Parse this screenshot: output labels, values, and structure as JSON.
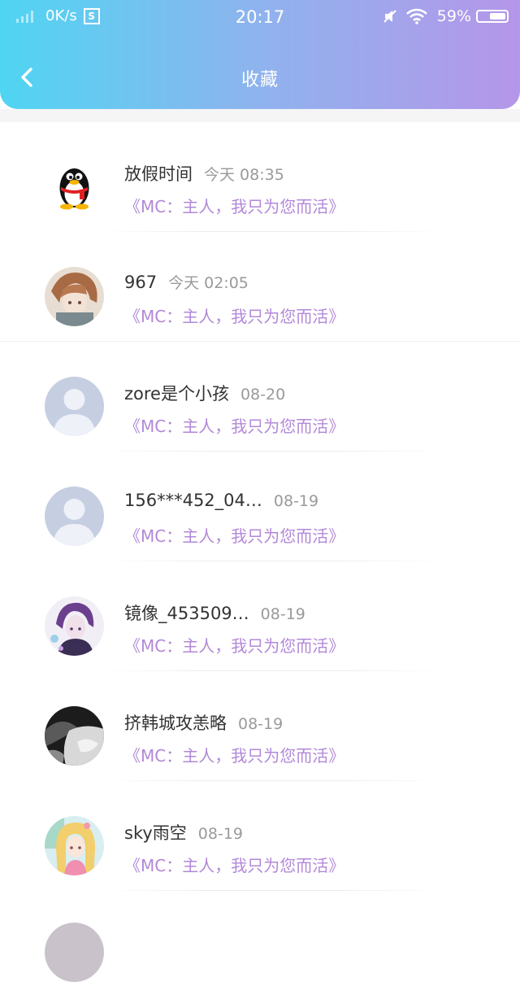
{
  "status_bar": {
    "speed": "0K/s",
    "s_icon": "S",
    "time": "20:17",
    "battery": "59%",
    "battery_level": 0.59
  },
  "header": {
    "title": "收藏",
    "back_icon": "chevron-left-icon"
  },
  "items": [
    {
      "name": "放假时间",
      "time": "今天 08:35",
      "desc": "《MC：主人，我只为您而活》",
      "avatar": "qq-penguin"
    },
    {
      "name": "967",
      "time": "今天 02:05",
      "desc": "《MC：主人，我只为您而活》",
      "avatar": "anime-brown"
    },
    {
      "name": "zore是个小孩",
      "time": "08-20",
      "desc": "《MC：主人，我只为您而活》",
      "avatar": "default-user"
    },
    {
      "name": "156***452_04…",
      "time": "08-19",
      "desc": "《MC：主人，我只为您而活》",
      "avatar": "default-user"
    },
    {
      "name": "镜像_453509…",
      "time": "08-19",
      "desc": "《MC：主人，我只为您而活》",
      "avatar": "anime-purple"
    },
    {
      "name": "挤韩城攻恙略",
      "time": "08-19",
      "desc": "《MC：主人，我只为您而活》",
      "avatar": "grayscale-photo"
    },
    {
      "name": "sky雨空",
      "time": "08-19",
      "desc": "《MC：主人，我只为您而活》",
      "avatar": "anime-blonde"
    }
  ],
  "colors": {
    "header_gradient_start": "#4fd5f2",
    "header_gradient_end": "#b596e8",
    "desc": "#b288d8",
    "time": "#9a9a9a"
  }
}
